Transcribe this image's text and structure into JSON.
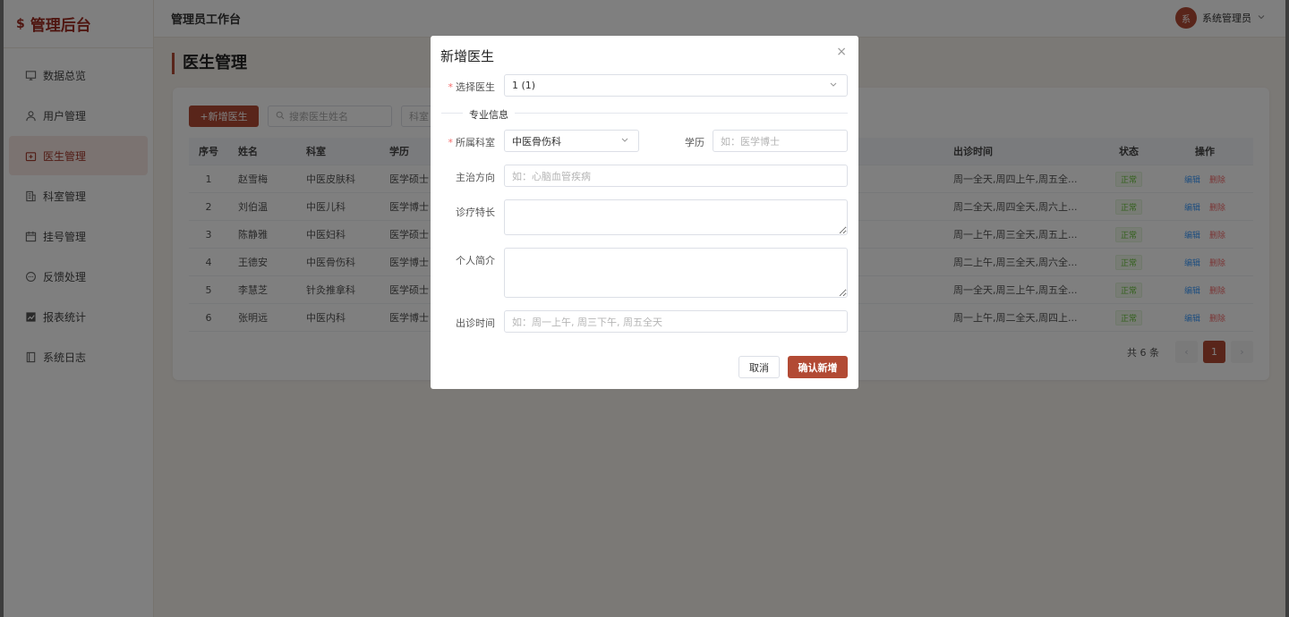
{
  "app": {
    "logo_mark": "$",
    "logo_text": "管理后台",
    "header_title": "管理员工作台",
    "user_avatar": "系",
    "user_name": "系统管理员"
  },
  "sidebar": {
    "items": [
      {
        "label": "数据总览",
        "icon": "dashboard-icon"
      },
      {
        "label": "用户管理",
        "icon": "user-icon"
      },
      {
        "label": "医生管理",
        "icon": "doctor-icon",
        "active": true
      },
      {
        "label": "科室管理",
        "icon": "building-icon"
      },
      {
        "label": "挂号管理",
        "icon": "calendar-icon"
      },
      {
        "label": "反馈处理",
        "icon": "chat-icon"
      },
      {
        "label": "报表统计",
        "icon": "chart-icon"
      },
      {
        "label": "系统日志",
        "icon": "log-icon"
      }
    ]
  },
  "main": {
    "page_title": "医生管理",
    "add_button": "+新增医生",
    "search_placeholder": "搜索医生姓名",
    "dept_filter_placeholder": "科室",
    "table": {
      "headers": [
        "序号",
        "姓名",
        "科室",
        "学历",
        "出诊时间",
        "状态",
        "操作"
      ],
      "rows": [
        {
          "no": "1",
          "name": "赵雪梅",
          "dept": "中医皮肤科",
          "edu": "医学硕士",
          "time": "周一全天,周四上午,周五全...",
          "status": "正常"
        },
        {
          "no": "2",
          "name": "刘伯温",
          "dept": "中医儿科",
          "edu": "医学博士",
          "time": "周二全天,周四全天,周六上...",
          "status": "正常"
        },
        {
          "no": "3",
          "name": "陈静雅",
          "dept": "中医妇科",
          "edu": "医学硕士",
          "time": "周一上午,周三全天,周五上...",
          "status": "正常"
        },
        {
          "no": "4",
          "name": "王德安",
          "dept": "中医骨伤科",
          "edu": "医学博士",
          "time": "周二上午,周三全天,周六全...",
          "status": "正常"
        },
        {
          "no": "5",
          "name": "李慧芝",
          "dept": "针灸推拿科",
          "edu": "医学硕士",
          "time": "周一全天,周三上午,周五全...",
          "status": "正常"
        },
        {
          "no": "6",
          "name": "张明远",
          "dept": "中医内科",
          "edu": "医学博士",
          "time": "周一上午,周二全天,周四上...",
          "status": "正常"
        }
      ],
      "edit_label": "编辑",
      "delete_label": "删除"
    },
    "pagination": {
      "total": "共 6 条",
      "current_page": "1",
      "prev": "‹",
      "next": "›"
    }
  },
  "dialog": {
    "title": "新增医生",
    "close": "×",
    "select_doctor_label": "选择医生",
    "select_doctor_value": "1 (1)",
    "section_title": "专业信息",
    "dept_label": "所属科室",
    "dept_value": "中医骨伤科",
    "edu_label": "学历",
    "edu_placeholder": "如：医学博士",
    "specialty_label": "主治方向",
    "specialty_placeholder": "如：心脑血管疾病",
    "expertise_label": "诊疗特长",
    "intro_label": "个人简介",
    "schedule_label": "出诊时间",
    "schedule_placeholder": "如：周一上午, 周三下午, 周五全天",
    "cancel": "取消",
    "confirm": "确认新增"
  }
}
